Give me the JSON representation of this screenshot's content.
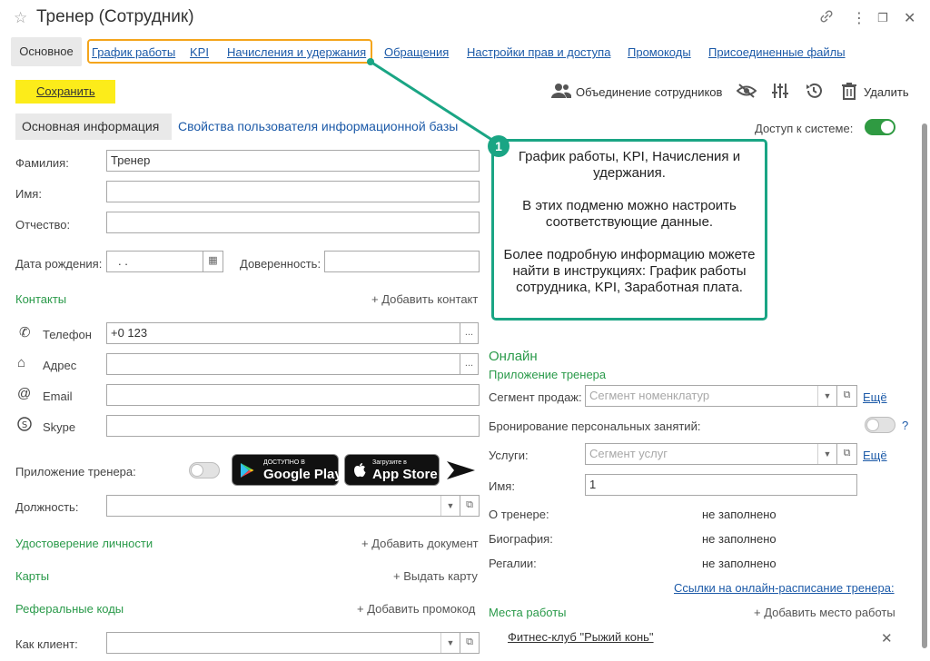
{
  "window": {
    "title": "Тренер (Сотрудник)"
  },
  "tabs": {
    "main": "Основное",
    "schedule": "График работы",
    "kpi": "KPI",
    "payroll": "Начисления и удержания",
    "requests": "Обращения",
    "access": "Настройки прав и доступа",
    "promo": "Промокоды",
    "files": "Присоединенные файлы"
  },
  "toolbar": {
    "save": "Сохранить",
    "merge": "Объединение сотрудников",
    "delete": "Удалить"
  },
  "subtabs": {
    "basic": "Основная информация",
    "user": "Свойства пользователя информационной базы"
  },
  "access": {
    "label": "Доступ к системе:",
    "on": true
  },
  "form": {
    "last_name_label": "Фамилия:",
    "last_name_value": "Тренер",
    "first_name_label": "Имя:",
    "middle_name_label": "Отчество:",
    "birth_label": "Дата рождения:",
    "birth_value": " .  .",
    "proxy_label": "Доверенность:",
    "contacts_title": "Контакты",
    "add_contact": "+ Добавить контакт",
    "phone_label": "Телефон",
    "phone_value": "+0 123",
    "address_label": "Адрес",
    "email_label": "Email",
    "skype_label": "Skype",
    "trainer_app_label": "Приложение тренера:",
    "position_label": "Должность:",
    "identity_title": "Удостоверение личности",
    "add_document": "+ Добавить документ",
    "cards_title": "Карты",
    "issue_card": "+ Выдать карту",
    "referral_title": "Реферальные коды",
    "add_promo": "+ Добавить промокод",
    "as_client_label": "Как клиент:"
  },
  "stores": {
    "google_small": "ДОСТУПНО В",
    "google_big": "Google Play",
    "apple_small": "Загрузите в",
    "apple_big": "App Store"
  },
  "callout": {
    "number": "1",
    "p1": "График работы, KPI, Начисления и удержания.",
    "p2": "В этих подменю можно настроить соответствующие данные.",
    "p3": "Более подробную информацию можете найти в инструкциях: График работы сотрудника, KPI, Заработная плата."
  },
  "online": {
    "title": "Онлайн",
    "app_title": "Приложение тренера",
    "segment_label": "Сегмент продаж:",
    "segment_placeholder": "Сегмент номенклатур",
    "more1": "Ещё",
    "booking_label": "Бронирование персональных занятий:",
    "help": "?",
    "services_label": "Услуги:",
    "services_placeholder": "Сегмент услуг",
    "more2": "Ещё",
    "name_label": "Имя:",
    "name_value": "1",
    "about_label": "О тренере:",
    "about_value": "не заполнено",
    "bio_label": "Биография:",
    "bio_value": "не заполнено",
    "awards_label": "Регалии:",
    "awards_value": "не заполнено",
    "schedule_link": "Ссылки на онлайн-расписание тренера:",
    "workplaces_title": "Места работы",
    "add_workplace": "+ Добавить место работы",
    "workplace_item": "Фитнес-клуб \"Рыжий конь\""
  },
  "colors": {
    "accent_green": "#2a9a4a",
    "link_blue": "#1c5aa8",
    "save_yellow": "#fcec1a",
    "highlight_orange": "#f4a51c",
    "callout_teal": "#1aa584"
  }
}
